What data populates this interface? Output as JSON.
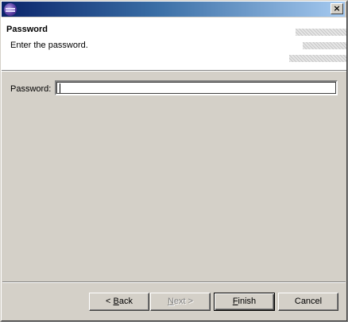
{
  "window": {
    "title": "",
    "icon": "eclipse-icon",
    "close_label": "×"
  },
  "header": {
    "title": "Password",
    "description": "Enter the password."
  },
  "form": {
    "password_label": "Password:",
    "password_value": ""
  },
  "buttons": {
    "back_prefix": "< ",
    "back_mnemonic": "B",
    "back_suffix": "ack",
    "next_prefix": "",
    "next_mnemonic": "N",
    "next_suffix": "ext >",
    "finish_prefix": "",
    "finish_mnemonic": "F",
    "finish_suffix": "inish",
    "cancel_label": "Cancel"
  },
  "colors": {
    "titlebar_start": "#0a246a",
    "titlebar_end": "#a6caf0",
    "dialog_bg": "#d4d0c8"
  }
}
